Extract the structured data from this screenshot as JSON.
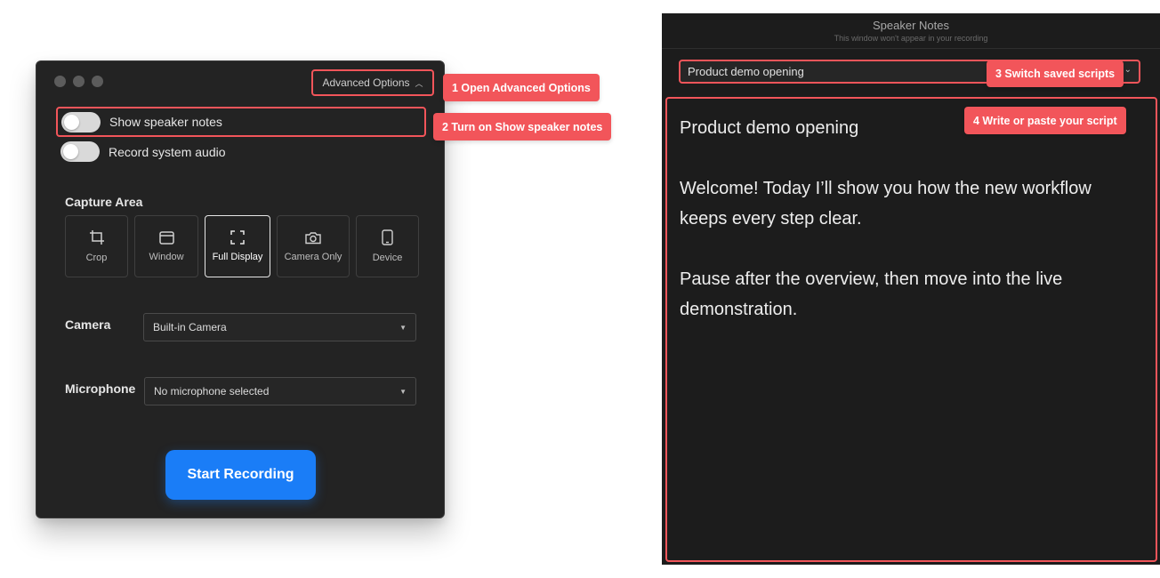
{
  "recorder": {
    "advanced_options_label": "Advanced Options",
    "toggles": [
      {
        "label": "Show speaker notes",
        "on": false
      },
      {
        "label": "Record system audio",
        "on": false
      }
    ],
    "capture_area": {
      "label": "Capture Area",
      "options": [
        {
          "label": "Crop",
          "icon": "crop-icon"
        },
        {
          "label": "Window",
          "icon": "window-icon"
        },
        {
          "label": "Full Display",
          "icon": "fullscreen-icon",
          "selected": true
        },
        {
          "label": "Camera Only",
          "icon": "camera-icon"
        },
        {
          "label": "Device",
          "icon": "device-icon"
        }
      ]
    },
    "camera": {
      "label": "Camera",
      "value": "Built-in Camera"
    },
    "microphone": {
      "label": "Microphone",
      "value": "No microphone selected"
    },
    "start_label": "Start Recording"
  },
  "callouts": [
    "1 Open Advanced Options",
    "2 Turn on Show speaker notes",
    "3 Switch saved scripts",
    "4 Write or paste your script"
  ],
  "speaker_notes": {
    "title": "Speaker Notes",
    "subtitle": "This window won't appear in your recording",
    "script_select": "Product demo opening",
    "script_paragraphs": [
      "Product demo opening",
      "Welcome! Today I’ll show you how the new workflow keeps every step clear.",
      "Pause after the overview, then move into the live demonstration."
    ]
  },
  "colors": {
    "accent_callout": "#f2555a",
    "primary_button": "#1a7df7",
    "window_bg": "#232323"
  }
}
